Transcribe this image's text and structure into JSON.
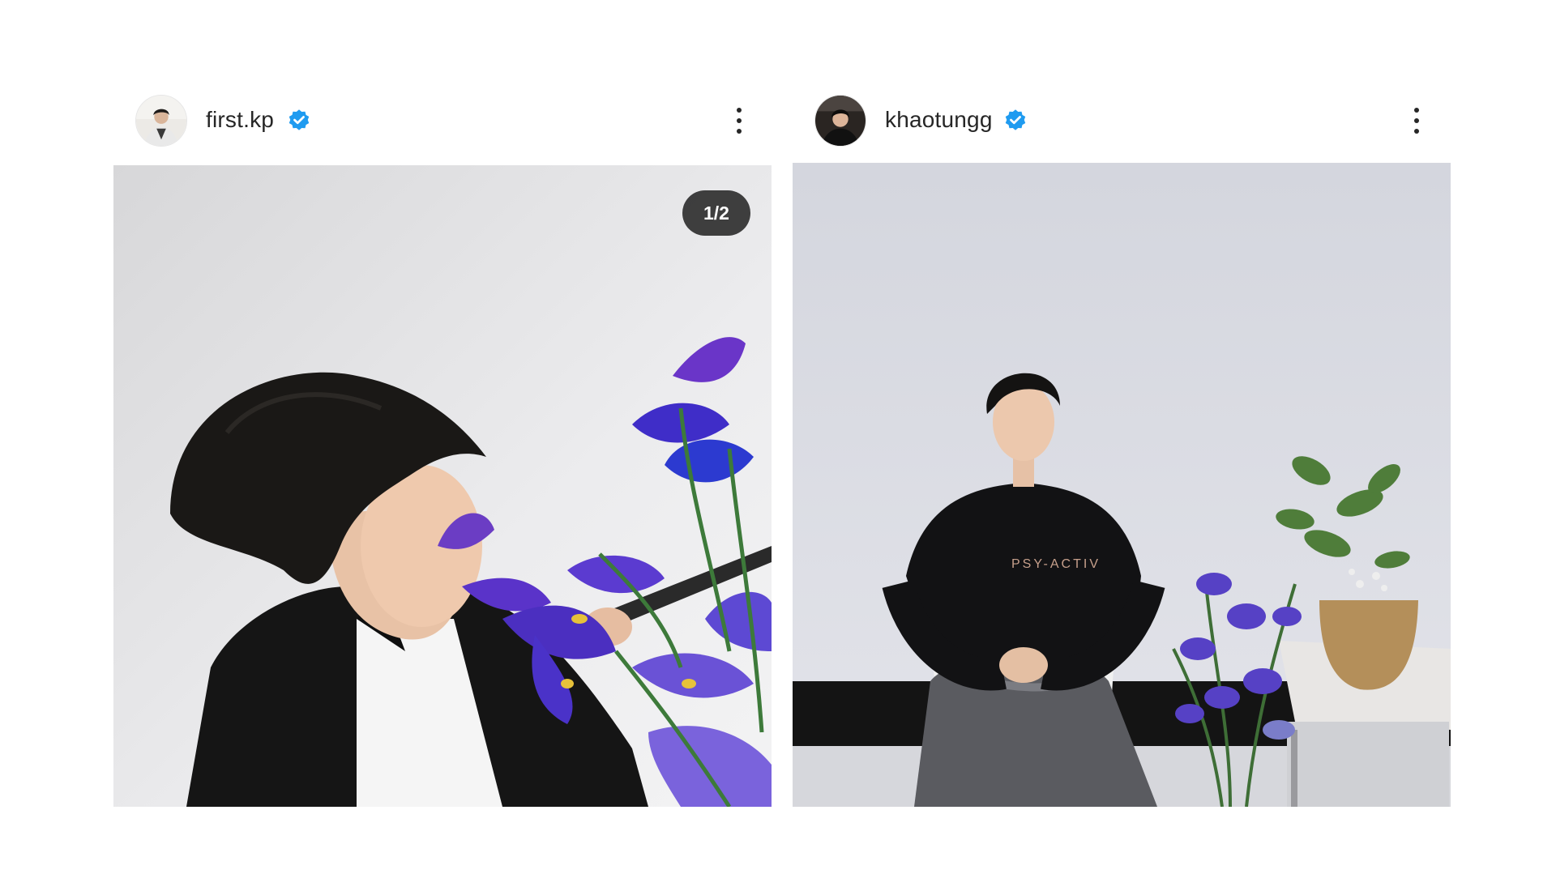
{
  "posts": [
    {
      "username": "first.kp",
      "verified": true,
      "verified_icon": "verified-badge-icon",
      "more_icon": "more-options-icon",
      "carousel_counter": "1/2",
      "colors": {
        "verified": "#1f9bf0",
        "text": "#262626",
        "counter_bg": "#262626"
      }
    },
    {
      "username": "khaotungg",
      "verified": true,
      "verified_icon": "verified-badge-icon",
      "more_icon": "more-options-icon",
      "colors": {
        "verified": "#1f9bf0",
        "text": "#262626"
      }
    }
  ]
}
